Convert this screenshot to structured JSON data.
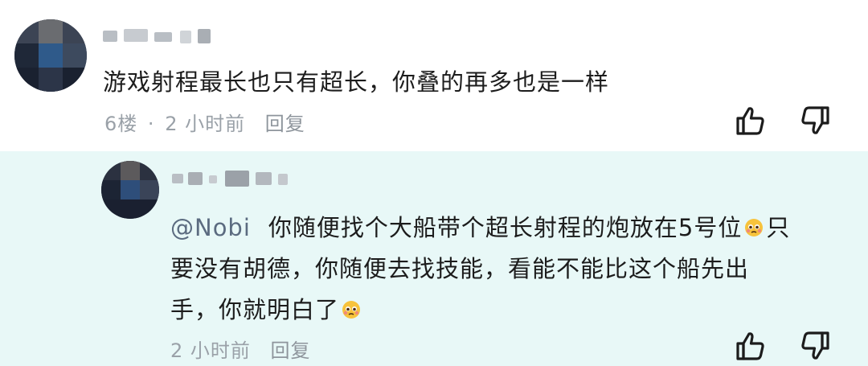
{
  "main_comment": {
    "text": "游戏射程最长也只有超长，你叠的再多也是一样",
    "floor": "6楼",
    "separator": "·",
    "time": "2 小时前",
    "reply_label": "回复"
  },
  "reply": {
    "mention": "@Nobi",
    "text_1": "你随便找个大船带个超长射程的炮放在5号位",
    "text_2": "只",
    "text_3": "要没有胡德，你随便去找技能，看能不能比这个船先出",
    "text_4": "手，你就明白了",
    "time": "2 小时前",
    "reply_label": "回复"
  },
  "icons": {
    "like": "thumbs-up-icon",
    "dislike": "thumbs-down-icon",
    "emoji": "pleading-face-emoji"
  },
  "colors": {
    "reply_background": "#e8f8f7",
    "meta_text": "#9aa1a8",
    "mention": "#5b6b80"
  }
}
